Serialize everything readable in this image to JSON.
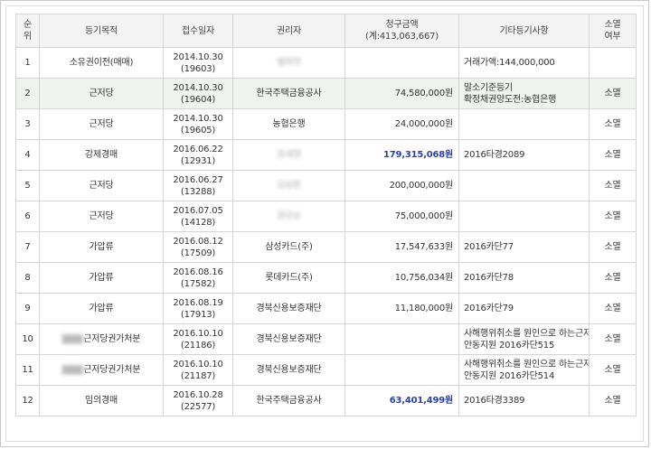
{
  "table": {
    "headers": {
      "rank_line1": "순",
      "rank_line2": "위",
      "purpose": "등기목적",
      "receipt": "접수일자",
      "holder": "권리자",
      "claim_line1": "청구금액",
      "claim_line2": "(계:413,063,667)",
      "etc": "기타등기사항",
      "extinct_line1": "소멸",
      "extinct_line2": "여부"
    },
    "rows": [
      {
        "rank": "1",
        "purpose_blur": "",
        "purpose": "소유권이전(매매)",
        "date": "2014.10.30",
        "no": "(19603)",
        "holder": "엘파연",
        "holder_blur": true,
        "amount": "",
        "etc1": "거래가액:144,000,000",
        "etc2": "",
        "status": ""
      },
      {
        "rank": "2",
        "purpose_blur": "",
        "purpose": "근저당",
        "date": "2014.10.30",
        "no": "(19604)",
        "holder": "한국주택금융공사",
        "holder_blur": false,
        "amount": "74,580,000원",
        "etc1": "말소기준등기",
        "etc2": "확정채권양도전:농협은행",
        "status": "소멸"
      },
      {
        "rank": "3",
        "purpose_blur": "",
        "purpose": "근저당",
        "date": "2014.10.30",
        "no": "(19605)",
        "holder": "농협은행",
        "holder_blur": false,
        "amount": "24,000,000원",
        "etc1": "",
        "etc2": "",
        "status": "소멸"
      },
      {
        "rank": "4",
        "purpose_blur": "",
        "purpose": "강제경매",
        "date": "2016.06.22",
        "no": "(12931)",
        "holder": "권세영",
        "holder_blur": true,
        "amount": "179,315,068원",
        "etc1": "2016타경2089",
        "etc2": "",
        "status": "소멸"
      },
      {
        "rank": "5",
        "purpose_blur": "",
        "purpose": "근저당",
        "date": "2016.06.27",
        "no": "(13288)",
        "holder": "김성훈",
        "holder_blur": true,
        "amount": "200,000,000원",
        "etc1": "",
        "etc2": "",
        "status": "소멸"
      },
      {
        "rank": "6",
        "purpose_blur": "",
        "purpose": "근저당",
        "date": "2016.07.05",
        "no": "(14128)",
        "holder": "권규순",
        "holder_blur": true,
        "amount": "75,000,000원",
        "etc1": "",
        "etc2": "",
        "status": "소멸"
      },
      {
        "rank": "7",
        "purpose_blur": "",
        "purpose": "가압류",
        "date": "2016.08.12",
        "no": "(17509)",
        "holder": "삼성카드(주)",
        "holder_blur": false,
        "amount": "17,547,633원",
        "etc1": "2016카단77",
        "etc2": "",
        "status": "소멸"
      },
      {
        "rank": "8",
        "purpose_blur": "",
        "purpose": "가압류",
        "date": "2016.08.16",
        "no": "(17582)",
        "holder": "롯데카드(주)",
        "holder_blur": false,
        "amount": "10,756,034원",
        "etc1": "2016카단78",
        "etc2": "",
        "status": "소멸"
      },
      {
        "rank": "9",
        "purpose_blur": "",
        "purpose": "가압류",
        "date": "2016.08.19",
        "no": "(17913)",
        "holder": "경북신용보증재단",
        "holder_blur": false,
        "amount": "11,180,000원",
        "etc1": "2016카단79",
        "etc2": "",
        "status": "소멸"
      },
      {
        "rank": "10",
        "purpose_blur": "▇▇▇",
        "purpose": "근저당권가처분",
        "date": "2016.10.10",
        "no": "(21186)",
        "holder": "경북신용보증재단",
        "holder_blur": false,
        "amount": "",
        "etc1": "사해행위취소를 원인으로 하는근저당권말소등기청구권,",
        "etc2": "안동지원 2016카단515",
        "status": "소멸"
      },
      {
        "rank": "11",
        "purpose_blur": "▇▇▇",
        "purpose": "근저당권가처분",
        "date": "2016.10.10",
        "no": "(21187)",
        "holder": "경북신용보증재단",
        "holder_blur": false,
        "amount": "",
        "etc1": "사해행위취소를 원인으로 하는근저당권말소등기청구권,",
        "etc2": "안동지원 2016카단514",
        "status": "소멸"
      },
      {
        "rank": "12",
        "purpose_blur": "",
        "purpose": "임의경매",
        "date": "2016.10.28",
        "no": "(22577)",
        "holder": "한국주택금융공사",
        "holder_blur": false,
        "amount": "63,401,499원",
        "etc1": "2016타경3389",
        "etc2": "",
        "status": "소멸"
      }
    ],
    "colors": {
      "header_bg": "#f3f3f3",
      "highlight_row_bg": "#eef3ee",
      "emphasis_amount": "#2b3fa8",
      "border": "#d4d4d4"
    }
  }
}
